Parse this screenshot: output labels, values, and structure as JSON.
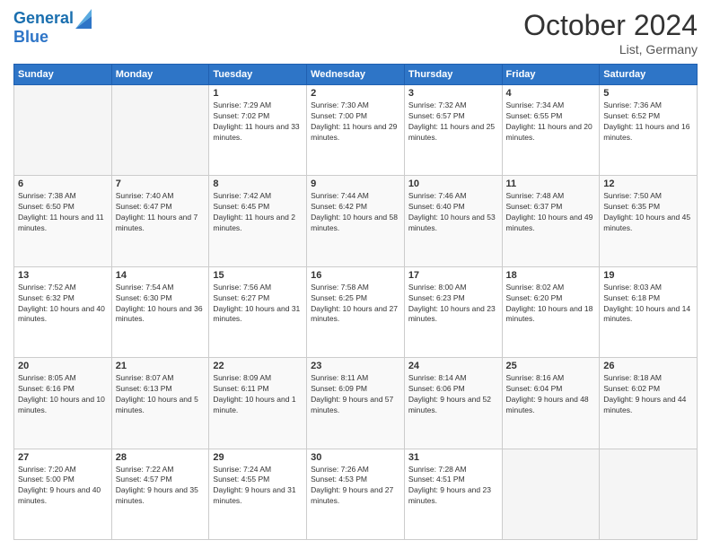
{
  "header": {
    "logo_line1": "General",
    "logo_line2": "Blue",
    "month": "October 2024",
    "location": "List, Germany"
  },
  "weekdays": [
    "Sunday",
    "Monday",
    "Tuesday",
    "Wednesday",
    "Thursday",
    "Friday",
    "Saturday"
  ],
  "weeks": [
    [
      {
        "day": "",
        "info": ""
      },
      {
        "day": "",
        "info": ""
      },
      {
        "day": "1",
        "info": "Sunrise: 7:29 AM\nSunset: 7:02 PM\nDaylight: 11 hours and 33 minutes."
      },
      {
        "day": "2",
        "info": "Sunrise: 7:30 AM\nSunset: 7:00 PM\nDaylight: 11 hours and 29 minutes."
      },
      {
        "day": "3",
        "info": "Sunrise: 7:32 AM\nSunset: 6:57 PM\nDaylight: 11 hours and 25 minutes."
      },
      {
        "day": "4",
        "info": "Sunrise: 7:34 AM\nSunset: 6:55 PM\nDaylight: 11 hours and 20 minutes."
      },
      {
        "day": "5",
        "info": "Sunrise: 7:36 AM\nSunset: 6:52 PM\nDaylight: 11 hours and 16 minutes."
      }
    ],
    [
      {
        "day": "6",
        "info": "Sunrise: 7:38 AM\nSunset: 6:50 PM\nDaylight: 11 hours and 11 minutes."
      },
      {
        "day": "7",
        "info": "Sunrise: 7:40 AM\nSunset: 6:47 PM\nDaylight: 11 hours and 7 minutes."
      },
      {
        "day": "8",
        "info": "Sunrise: 7:42 AM\nSunset: 6:45 PM\nDaylight: 11 hours and 2 minutes."
      },
      {
        "day": "9",
        "info": "Sunrise: 7:44 AM\nSunset: 6:42 PM\nDaylight: 10 hours and 58 minutes."
      },
      {
        "day": "10",
        "info": "Sunrise: 7:46 AM\nSunset: 6:40 PM\nDaylight: 10 hours and 53 minutes."
      },
      {
        "day": "11",
        "info": "Sunrise: 7:48 AM\nSunset: 6:37 PM\nDaylight: 10 hours and 49 minutes."
      },
      {
        "day": "12",
        "info": "Sunrise: 7:50 AM\nSunset: 6:35 PM\nDaylight: 10 hours and 45 minutes."
      }
    ],
    [
      {
        "day": "13",
        "info": "Sunrise: 7:52 AM\nSunset: 6:32 PM\nDaylight: 10 hours and 40 minutes."
      },
      {
        "day": "14",
        "info": "Sunrise: 7:54 AM\nSunset: 6:30 PM\nDaylight: 10 hours and 36 minutes."
      },
      {
        "day": "15",
        "info": "Sunrise: 7:56 AM\nSunset: 6:27 PM\nDaylight: 10 hours and 31 minutes."
      },
      {
        "day": "16",
        "info": "Sunrise: 7:58 AM\nSunset: 6:25 PM\nDaylight: 10 hours and 27 minutes."
      },
      {
        "day": "17",
        "info": "Sunrise: 8:00 AM\nSunset: 6:23 PM\nDaylight: 10 hours and 23 minutes."
      },
      {
        "day": "18",
        "info": "Sunrise: 8:02 AM\nSunset: 6:20 PM\nDaylight: 10 hours and 18 minutes."
      },
      {
        "day": "19",
        "info": "Sunrise: 8:03 AM\nSunset: 6:18 PM\nDaylight: 10 hours and 14 minutes."
      }
    ],
    [
      {
        "day": "20",
        "info": "Sunrise: 8:05 AM\nSunset: 6:16 PM\nDaylight: 10 hours and 10 minutes."
      },
      {
        "day": "21",
        "info": "Sunrise: 8:07 AM\nSunset: 6:13 PM\nDaylight: 10 hours and 5 minutes."
      },
      {
        "day": "22",
        "info": "Sunrise: 8:09 AM\nSunset: 6:11 PM\nDaylight: 10 hours and 1 minute."
      },
      {
        "day": "23",
        "info": "Sunrise: 8:11 AM\nSunset: 6:09 PM\nDaylight: 9 hours and 57 minutes."
      },
      {
        "day": "24",
        "info": "Sunrise: 8:14 AM\nSunset: 6:06 PM\nDaylight: 9 hours and 52 minutes."
      },
      {
        "day": "25",
        "info": "Sunrise: 8:16 AM\nSunset: 6:04 PM\nDaylight: 9 hours and 48 minutes."
      },
      {
        "day": "26",
        "info": "Sunrise: 8:18 AM\nSunset: 6:02 PM\nDaylight: 9 hours and 44 minutes."
      }
    ],
    [
      {
        "day": "27",
        "info": "Sunrise: 7:20 AM\nSunset: 5:00 PM\nDaylight: 9 hours and 40 minutes."
      },
      {
        "day": "28",
        "info": "Sunrise: 7:22 AM\nSunset: 4:57 PM\nDaylight: 9 hours and 35 minutes."
      },
      {
        "day": "29",
        "info": "Sunrise: 7:24 AM\nSunset: 4:55 PM\nDaylight: 9 hours and 31 minutes."
      },
      {
        "day": "30",
        "info": "Sunrise: 7:26 AM\nSunset: 4:53 PM\nDaylight: 9 hours and 27 minutes."
      },
      {
        "day": "31",
        "info": "Sunrise: 7:28 AM\nSunset: 4:51 PM\nDaylight: 9 hours and 23 minutes."
      },
      {
        "day": "",
        "info": ""
      },
      {
        "day": "",
        "info": ""
      }
    ]
  ]
}
